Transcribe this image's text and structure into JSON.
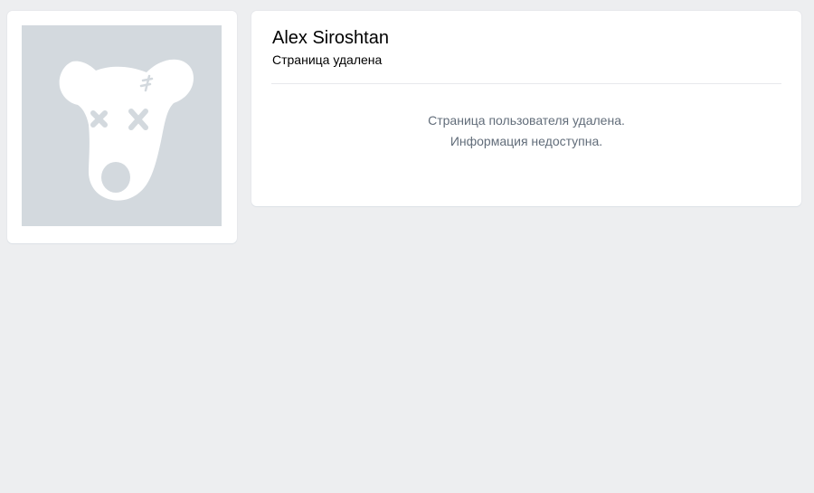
{
  "profile": {
    "name": "Alex Siroshtan",
    "status": "Страница удалена"
  },
  "deleted_notice": {
    "line1": "Страница пользователя удалена.",
    "line2": "Информация недоступна."
  },
  "avatar": {
    "icon": "deleted-dog-icon",
    "background_color": "#d3d9de",
    "figure_color": "#ffffff"
  },
  "colors": {
    "page_background": "#edeef0",
    "card_background": "#ffffff",
    "muted_text": "#626d7a"
  }
}
